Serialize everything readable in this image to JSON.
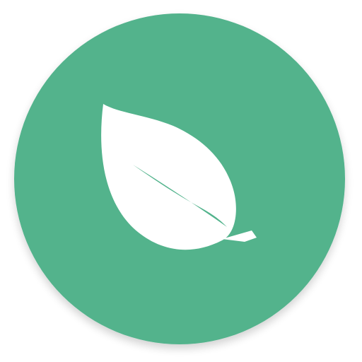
{
  "app_icon": {
    "icon": "leaf-icon",
    "colors": {
      "background": "#ffffff",
      "circle": "#52b38c",
      "circle_shadow": "#3f8f70",
      "leaf": "#ffffff"
    }
  }
}
